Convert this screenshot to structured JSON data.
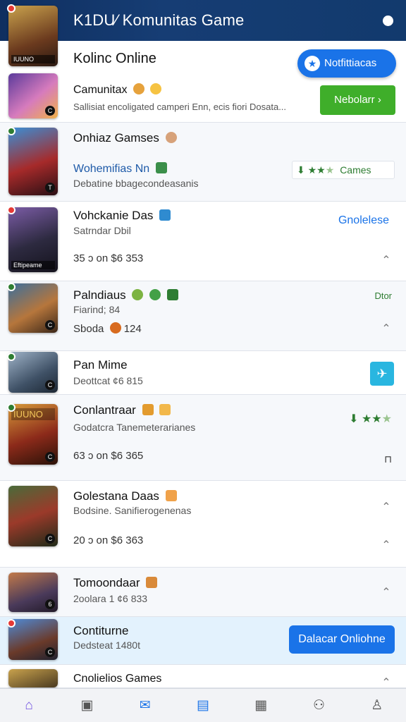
{
  "header": {
    "title": "K1DU⁄ Komunitas Game"
  },
  "top_card": {
    "title": "Kolinc Online",
    "notif_label": "Notfittiacas",
    "sub_title": "Camunitax",
    "desc": "Sallisiat encoligated camperi Enn, ecis fiori Dosata...",
    "green_button": "Nebolarr"
  },
  "rows": [
    {
      "title": "Onhiaz Gamses",
      "sub": "Wohemifias Nn",
      "desc": "Debatine bbagecondeasanis",
      "rating_label": "Cames"
    },
    {
      "title": "Vohckanie Das",
      "sub": "Satrndar Dbil",
      "price": "35 ɔ on $6 353",
      "action": "Gnolelese",
      "thumb_caption": "Eftipeame"
    },
    {
      "title": "Palndiaus",
      "sub": "Fiarind; 84",
      "price": "Sboda",
      "price_num": "124",
      "action": "Dtor"
    },
    {
      "title": "Pan Mime",
      "sub": "Deottcat ¢6 815"
    },
    {
      "title": "Conlantraar",
      "sub": "Godatcra Tanemeterarianes",
      "price": "63 ɔ on $6 365",
      "thumb_caption": "IUUNO"
    },
    {
      "title": "Golestana Daas",
      "sub": "Bodsine. Sanifierogenenas",
      "price": "20 ɔ on $6 363"
    },
    {
      "title": "Tomoondaar",
      "sub": "2oolara 1 ¢6 833"
    },
    {
      "title": "Contiturne",
      "sub": "Dedsteat 1480t",
      "action": "Dalacar Onliohne"
    },
    {
      "title": "Cnolielios Games"
    }
  ],
  "nav": [
    "home-icon",
    "store-icon",
    "mail-icon",
    "chart-icon",
    "calendar-icon",
    "profile-icon",
    "account-icon"
  ],
  "colors": {
    "header": "#123a6d",
    "accent": "#1a73e8",
    "green": "#3fae2a"
  }
}
